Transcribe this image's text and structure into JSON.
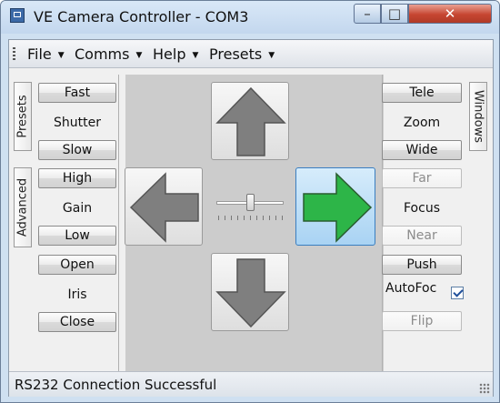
{
  "window": {
    "title": "VE Camera Controller - COM3",
    "close_glyph": "✕",
    "minimize_glyph": "–",
    "maximize_glyph": "□"
  },
  "menu": {
    "items": [
      "File",
      "Comms",
      "Help",
      "Presets"
    ],
    "caret": "▼"
  },
  "left_tabs": {
    "presets": "Presets",
    "advanced": "Advanced"
  },
  "right_tabs": {
    "windows": "Windows"
  },
  "shutter": {
    "fast": "Fast",
    "label": "Shutter",
    "slow": "Slow"
  },
  "gain": {
    "high": "High",
    "label": "Gain",
    "low": "Low"
  },
  "iris": {
    "open": "Open",
    "label": "Iris",
    "close": "Close"
  },
  "zoom": {
    "tele": "Tele",
    "label": "Zoom",
    "wide": "Wide"
  },
  "focus": {
    "far": "Far",
    "label": "Focus",
    "near": "Near",
    "push": "Push"
  },
  "autofocus": {
    "label": "AutoFoc",
    "checked": true
  },
  "flip": {
    "label": "Flip"
  },
  "pan_tilt": {
    "active_direction": "right",
    "speed_fraction": 0.5
  },
  "colors": {
    "arrow_gray": "#7f7f7f",
    "arrow_active": "#2db548",
    "close_red": "#c64632"
  },
  "status": {
    "text": "RS232 Connection Successful"
  }
}
